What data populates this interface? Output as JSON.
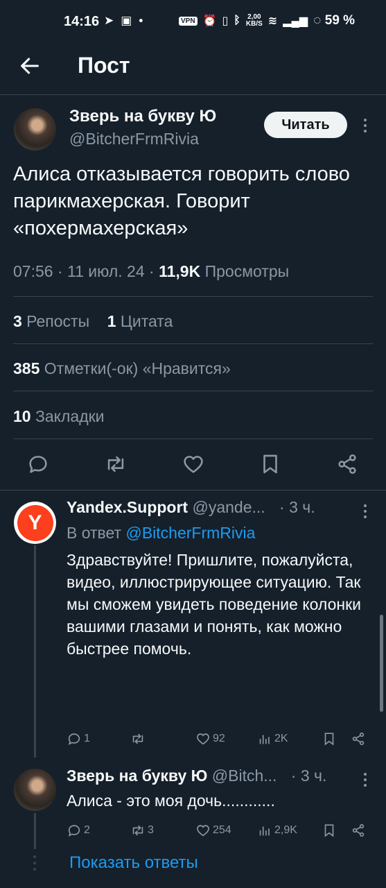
{
  "status_bar": {
    "time": "14:16",
    "vpn": "VPN",
    "net_speed_value": "2,00",
    "net_speed_unit": "KB/S",
    "battery": "59 %"
  },
  "header": {
    "title": "Пост"
  },
  "post": {
    "author_name": "Зверь на букву Ю",
    "author_handle": "@BitcherFrmRivia",
    "follow_label": "Читать",
    "text": "Алиса отказывается говорить слово парикмахерская. Говорит «похермахерская»",
    "time": "07:56 · 11 июл. 24 · ",
    "views_count": "11,9K",
    "views_label": " Просмотры",
    "reposts_count": "3",
    "reposts_label": " Репосты",
    "quotes_count": "1",
    "quotes_label": " Цитата",
    "likes_count": "385",
    "likes_label": " Отметки(-ок) «Нравится»",
    "bookmarks_count": "10",
    "bookmarks_label": " Закладки"
  },
  "replies": [
    {
      "name": "Yandex.Support",
      "handle": " @yande...",
      "time": " · 3 ч.",
      "reply_to_prefix": "В ответ ",
      "reply_to_handle": "@BitcherFrmRivia",
      "avatar_letter": "Y",
      "text": "Здравствуйте! Пришлите, пожалуйста, видео, иллюстрирующее ситуацию. Так мы сможем увидеть поведение колонки вашими глазами и понять, как можно быстрее помочь.",
      "comments": "1",
      "retweets": "",
      "likes": "92",
      "views": "2K"
    },
    {
      "name": "Зверь на букву Ю",
      "handle": " @Bitch...",
      "time": " · 3 ч.",
      "text": "Алиса - это моя дочь............",
      "comments": "2",
      "retweets": "3",
      "likes": "254",
      "views": "2,9K"
    }
  ],
  "show_replies_label": "Показать ответы",
  "colors": {
    "background": "#15202b",
    "accent": "#1d9bf0",
    "muted": "#8b98a5",
    "divider": "#38444d"
  }
}
